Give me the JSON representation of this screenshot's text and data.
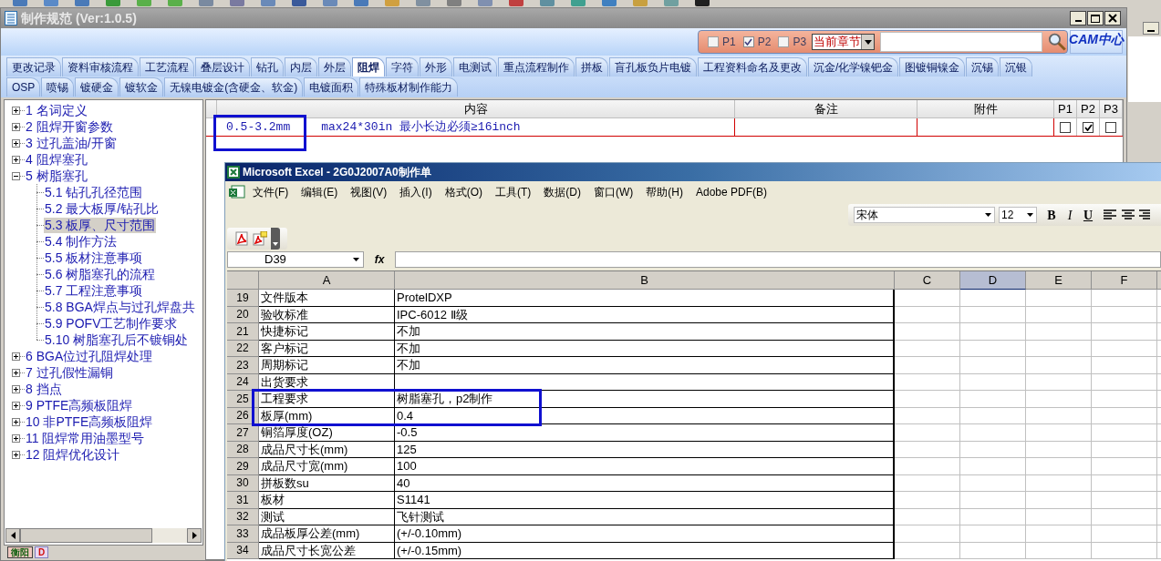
{
  "main_window": {
    "title": "制作规范 (Ver:1.0.5)"
  },
  "search_bar": {
    "filters": [
      {
        "label": "P1",
        "checked": false
      },
      {
        "label": "P2",
        "checked": true
      },
      {
        "label": "P3",
        "checked": false
      }
    ],
    "scope": "当前章节",
    "logo": "CAM中心"
  },
  "tab_rows": [
    [
      {
        "label": "更改记录",
        "selected": false
      },
      {
        "label": "资料审核流程",
        "selected": false
      },
      {
        "label": "工艺流程",
        "selected": false
      },
      {
        "label": "叠层设计",
        "selected": false
      },
      {
        "label": "钻孔",
        "selected": false
      },
      {
        "label": "内层",
        "selected": false
      },
      {
        "label": "外层",
        "selected": false
      },
      {
        "label": "阻焊",
        "selected": true
      },
      {
        "label": "字符",
        "selected": false
      },
      {
        "label": "外形",
        "selected": false
      },
      {
        "label": "电测试",
        "selected": false
      },
      {
        "label": "重点流程制作",
        "selected": false
      },
      {
        "label": "拼板",
        "selected": false
      },
      {
        "label": "盲孔板负片电镀",
        "selected": false
      },
      {
        "label": "工程资料命名及更改",
        "selected": false
      },
      {
        "label": "沉金/化学镍钯金",
        "selected": false
      },
      {
        "label": "图镀铜镍金",
        "selected": false
      },
      {
        "label": "沉锡",
        "selected": false
      },
      {
        "label": "沉银",
        "selected": false
      }
    ],
    [
      {
        "label": "OSP",
        "selected": false
      },
      {
        "label": "喷锡",
        "selected": false
      },
      {
        "label": "镀硬金",
        "selected": false
      },
      {
        "label": "镀软金",
        "selected": false
      },
      {
        "label": "无镍电镀金(含硬金、软金)",
        "selected": false
      },
      {
        "label": "电镀面积",
        "selected": false
      },
      {
        "label": "特殊板材制作能力",
        "selected": false
      }
    ]
  ],
  "tree": [
    {
      "label": "1 名词定义",
      "expanded": false,
      "selected": false
    },
    {
      "label": "2 阻焊开窗参数",
      "expanded": false,
      "selected": false
    },
    {
      "label": "3 过孔盖油/开窗",
      "expanded": false,
      "selected": false
    },
    {
      "label": "4 阻焊塞孔",
      "expanded": false,
      "selected": false
    },
    {
      "label": "5 树脂塞孔",
      "expanded": true,
      "selected": false,
      "children": [
        {
          "label": "5.1 钻孔孔径范围",
          "selected": false
        },
        {
          "label": "5.2 最大板厚/钻孔比",
          "selected": false
        },
        {
          "label": "5.3 板厚、尺寸范围",
          "selected": true
        },
        {
          "label": "5.4 制作方法",
          "selected": false
        },
        {
          "label": "5.5 板材注意事项",
          "selected": false
        },
        {
          "label": "5.6 树脂塞孔的流程",
          "selected": false
        },
        {
          "label": "5.7 工程注意事项",
          "selected": false
        },
        {
          "label": "5.8 BGA焊点与过孔焊盘共",
          "selected": false
        },
        {
          "label": "5.9 POFV工艺制作要求",
          "selected": false
        },
        {
          "label": "5.10 树脂塞孔后不镀铜处",
          "selected": false
        }
      ]
    },
    {
      "label": "6 BGA位过孔阻焊处理",
      "expanded": false,
      "selected": false
    },
    {
      "label": "7 过孔假性漏铜",
      "expanded": false,
      "selected": false
    },
    {
      "label": "8 挡点",
      "expanded": false,
      "selected": false
    },
    {
      "label": "9 PTFE高频板阻焊",
      "expanded": false,
      "selected": false
    },
    {
      "label": "10 非PTFE高频板阻焊",
      "expanded": false,
      "selected": false
    },
    {
      "label": "11 阻焊常用油墨型号",
      "expanded": false,
      "selected": false
    },
    {
      "label": "12 阻焊优化设计",
      "expanded": false,
      "selected": false
    }
  ],
  "bottom_tabs": [
    "衡阳",
    "D"
  ],
  "spec_table": {
    "columns": [
      "内容",
      "备注",
      "附件",
      "P1",
      "P2",
      "P3"
    ],
    "rows": [
      {
        "range": "0.5-3.2mm",
        "content": "max24*30in 最小长边必须≥16inch",
        "p1": false,
        "p2": true,
        "p3": false
      }
    ]
  },
  "excel": {
    "title": "Microsoft Excel - 2G0J2007A0制作单",
    "menu": [
      "文件(F)",
      "编辑(E)",
      "视图(V)",
      "插入(I)",
      "格式(O)",
      "工具(T)",
      "数据(D)",
      "窗口(W)",
      "帮助(H)",
      "Adobe PDF(B)"
    ],
    "font": "宋体",
    "font_size": "12",
    "format_buttons": [
      "B",
      "I",
      "U"
    ],
    "name_box": "D39",
    "formula_label": "fx",
    "columns": [
      {
        "label": "A",
        "selected": false
      },
      {
        "label": "B",
        "selected": false
      },
      {
        "label": "C",
        "selected": false
      },
      {
        "label": "D",
        "selected": true
      },
      {
        "label": "E",
        "selected": false
      },
      {
        "label": "F",
        "selected": false
      }
    ],
    "rows": [
      {
        "row": "19",
        "a": "文件版本",
        "b": "ProtelDXP"
      },
      {
        "row": "20",
        "a": "验收标准",
        "b": "IPC-6012 Ⅱ级"
      },
      {
        "row": "21",
        "a": "快捷标记",
        "b": "不加"
      },
      {
        "row": "22",
        "a": "客户标记",
        "b": "不加"
      },
      {
        "row": "23",
        "a": "周期标记",
        "b": "不加"
      },
      {
        "row": "24",
        "a": "出货要求"
      },
      {
        "row": "25",
        "a": "工程要求",
        "b": "树脂塞孔，p2制作"
      },
      {
        "row": "26",
        "a": "板厚(mm)",
        "b": "0.4"
      },
      {
        "row": "27",
        "a": "铜箔厚度(OZ)",
        "b": "-0.5"
      },
      {
        "row": "28",
        "a": "成品尺寸长(mm)",
        "b": "125"
      },
      {
        "row": "29",
        "a": "成品尺寸宽(mm)",
        "b": "100"
      },
      {
        "row": "30",
        "a": "拼板数su",
        "b": "40"
      },
      {
        "row": "31",
        "a": "板材",
        "b": "S1141"
      },
      {
        "row": "32",
        "a": "测试",
        "b": "飞针测试"
      },
      {
        "row": "33",
        "a": "成品板厚公差(mm)",
        "b": "(+/-0.10mm)"
      },
      {
        "row": "34",
        "a": "成品尺寸长宽公差",
        "b": "(+/-0.15mm)"
      }
    ]
  }
}
